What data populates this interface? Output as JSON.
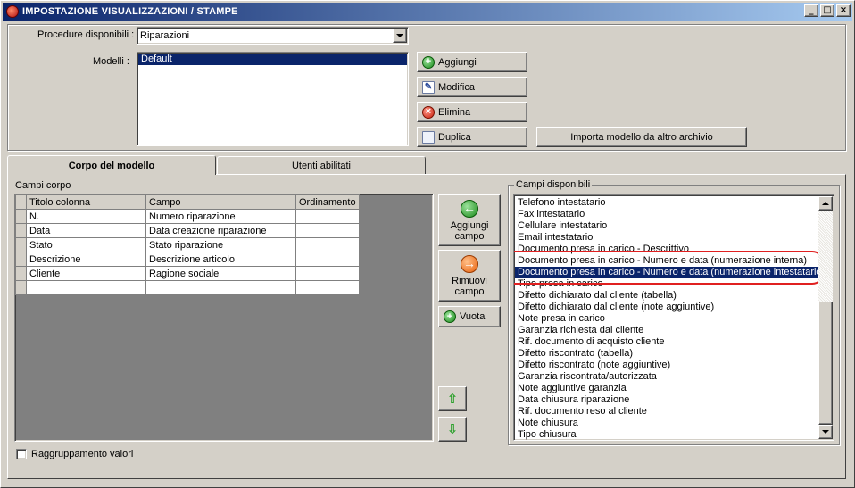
{
  "window": {
    "title": "IMPOSTAZIONE VISUALIZZAZIONI / STAMPE",
    "minimize": "_",
    "maximize": "□",
    "close": "×"
  },
  "top": {
    "procedure_label": "Procedure disponibili :",
    "procedure_value": "Riparazioni",
    "models_label": "Modelli :",
    "models": [
      "Default"
    ],
    "buttons": {
      "add": "Aggiungi",
      "edit": "Modifica",
      "delete": "Elimina",
      "duplicate": "Duplica",
      "import": "Importa modello da altro archivio"
    }
  },
  "tabs": [
    {
      "label": "Corpo del modello",
      "active": true
    },
    {
      "label": "Utenti abilitati",
      "active": false
    }
  ],
  "corpo": {
    "group_label": "Campi corpo",
    "columns": [
      "Titolo colonna",
      "Campo",
      "Ordinamento"
    ],
    "rows": [
      [
        "N.",
        "Numero riparazione",
        ""
      ],
      [
        "Data",
        "Data creazione riparazione",
        ""
      ],
      [
        "Stato",
        "Stato riparazione",
        ""
      ],
      [
        "Descrizione",
        "Descrizione articolo",
        ""
      ],
      [
        "Cliente",
        "Ragione sociale",
        ""
      ],
      [
        "",
        "",
        ""
      ]
    ],
    "add_field": "Aggiungi campo",
    "remove_field": "Rimuovi campo",
    "empty": "Vuota",
    "grouping_label": "Raggruppamento valori",
    "grouping_checked": false
  },
  "available": {
    "group_label": "Campi disponibili",
    "selected_index": 6,
    "highlight_indices": [
      5,
      6
    ],
    "items": [
      "Telefono intestatario",
      "Fax intestatario",
      "Cellulare intestatario",
      "Email intestatario",
      "Documento presa in carico - Descrittivo",
      "Documento presa in carico - Numero e data (numerazione interna)",
      "Documento presa in carico - Numero e data (numerazione intestatario)",
      "Tipo presa in carico",
      "Difetto dichiarato dal cliente (tabella)",
      "Difetto dichiarato dal cliente (note aggiuntive)",
      "Note presa in carico",
      "Garanzia richiesta dal cliente",
      "Rif. documento di acquisto cliente",
      "Difetto riscontrato (tabella)",
      "Difetto riscontrato (note aggiuntive)",
      "Garanzia riscontrata/autorizzata",
      "Note aggiuntive garanzia",
      "Data chiusura riparazione",
      "Rif. documento reso al cliente",
      "Note chiusura",
      "Tipo chiusura"
    ]
  },
  "colors": {
    "highlight": "#e02020",
    "selection": "#0a246a",
    "face": "#d4d0c8",
    "grid_empty": "#808080"
  }
}
